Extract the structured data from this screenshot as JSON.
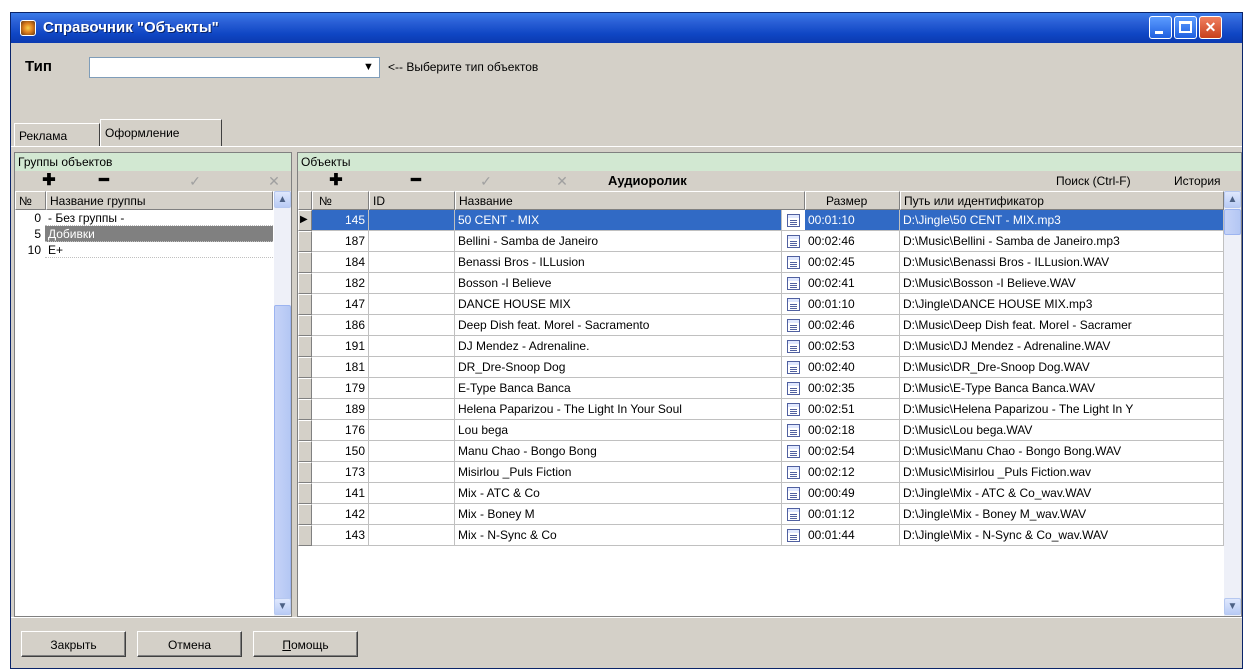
{
  "window": {
    "title": "Справочник \"Объекты\""
  },
  "type_row": {
    "label": "Тип",
    "value": "",
    "hint": "<-- Выберите тип объектов"
  },
  "tabs": [
    {
      "label": "Реклама",
      "active": false
    },
    {
      "label": "Оформление",
      "active": true
    }
  ],
  "groups_panel": {
    "header": "Группы объектов",
    "columns": {
      "num": "№",
      "name": "Название группы"
    },
    "rows": [
      {
        "num": "0",
        "name": " - Без группы -",
        "selected": false
      },
      {
        "num": "5",
        "name": "Добивки",
        "selected": true
      },
      {
        "num": "10",
        "name": "E+",
        "selected": false
      }
    ]
  },
  "objects_panel": {
    "header": "Объекты",
    "toolbar": {
      "type_label": "Аудиоролик",
      "search_label": "Поиск (Ctrl-F)",
      "history_label": "История"
    },
    "columns": {
      "num": "№",
      "id": "ID",
      "name": "Название",
      "size": "Размер",
      "path": "Путь или идентификатор"
    },
    "rows": [
      {
        "num": "145",
        "id": "",
        "name": "50 CENT - MIX",
        "size": "00:01:10",
        "path": "D:\\Jingle\\50 CENT - MIX.mp3",
        "selected": true
      },
      {
        "num": "187",
        "id": "",
        "name": "Bellini - Samba de Janeiro",
        "size": "00:02:46",
        "path": "D:\\Music\\Bellini - Samba de Janeiro.mp3"
      },
      {
        "num": "184",
        "id": "",
        "name": "Benassi Bros - ILLusion",
        "size": "00:02:45",
        "path": "D:\\Music\\Benassi Bros - ILLusion.WAV"
      },
      {
        "num": "182",
        "id": "",
        "name": "Bosson -I Believe",
        "size": "00:02:41",
        "path": "D:\\Music\\Bosson -I Believe.WAV"
      },
      {
        "num": "147",
        "id": "",
        "name": "DANCE HOUSE MIX",
        "size": "00:01:10",
        "path": "D:\\Jingle\\DANCE HOUSE MIX.mp3"
      },
      {
        "num": "186",
        "id": "",
        "name": "Deep Dish feat. Morel - Sacramento",
        "size": "00:02:46",
        "path": "D:\\Music\\Deep Dish feat. Morel - Sacramer"
      },
      {
        "num": "191",
        "id": "",
        "name": "DJ Mendez - Adrenaline.",
        "size": "00:02:53",
        "path": "D:\\Music\\DJ Mendez - Adrenaline.WAV"
      },
      {
        "num": "181",
        "id": "",
        "name": "DR_Dre-Snoop Dog",
        "size": "00:02:40",
        "path": "D:\\Music\\DR_Dre-Snoop Dog.WAV"
      },
      {
        "num": "179",
        "id": "",
        "name": "E-Type  Banca Banca",
        "size": "00:02:35",
        "path": "D:\\Music\\E-Type  Banca Banca.WAV"
      },
      {
        "num": "189",
        "id": "",
        "name": "Helena Paparizou - The Light In Your Soul",
        "size": "00:02:51",
        "path": "D:\\Music\\Helena Paparizou - The Light In Y"
      },
      {
        "num": "176",
        "id": "",
        "name": "Lou bega",
        "size": "00:02:18",
        "path": "D:\\Music\\Lou bega.WAV"
      },
      {
        "num": "150",
        "id": "",
        "name": "Manu Chao - Bongo Bong",
        "size": "00:02:54",
        "path": "D:\\Music\\Manu Chao - Bongo Bong.WAV"
      },
      {
        "num": "173",
        "id": "",
        "name": "Misirlou _Puls Fiction",
        "size": "00:02:12",
        "path": "D:\\Music\\Misirlou _Puls Fiction.wav"
      },
      {
        "num": "141",
        "id": "",
        "name": "Mix - ATC & Co",
        "size": "00:00:49",
        "path": "D:\\Jingle\\Mix - ATC & Co_wav.WAV"
      },
      {
        "num": "142",
        "id": "",
        "name": "Mix - Boney M",
        "size": "00:01:12",
        "path": "D:\\Jingle\\Mix - Boney M_wav.WAV"
      },
      {
        "num": "143",
        "id": "",
        "name": "Mix - N-Sync & Co",
        "size": "00:01:44",
        "path": "D:\\Jingle\\Mix - N-Sync & Co_wav.WAV"
      }
    ]
  },
  "buttons": {
    "close": "Закрыть",
    "cancel": "Отмена",
    "help_first": "П",
    "help_rest": "омощь"
  },
  "colors": {
    "selection": "#316ac5",
    "panel_header": "#d2e8d2",
    "face": "#d4d0c8"
  }
}
